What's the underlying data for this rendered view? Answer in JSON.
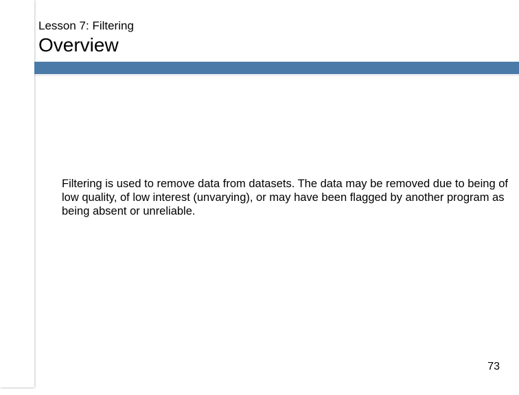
{
  "header": {
    "kicker": "Lesson 7: Filtering",
    "title": "Overview"
  },
  "body": {
    "paragraph": "Filtering is used to remove data from datasets.  The data may be removed due to being of low quality, of low interest (unvarying), or may have been flagged by another program as being absent or unreliable."
  },
  "page_number": "73",
  "colors": {
    "accent": "#4a7aa8"
  }
}
